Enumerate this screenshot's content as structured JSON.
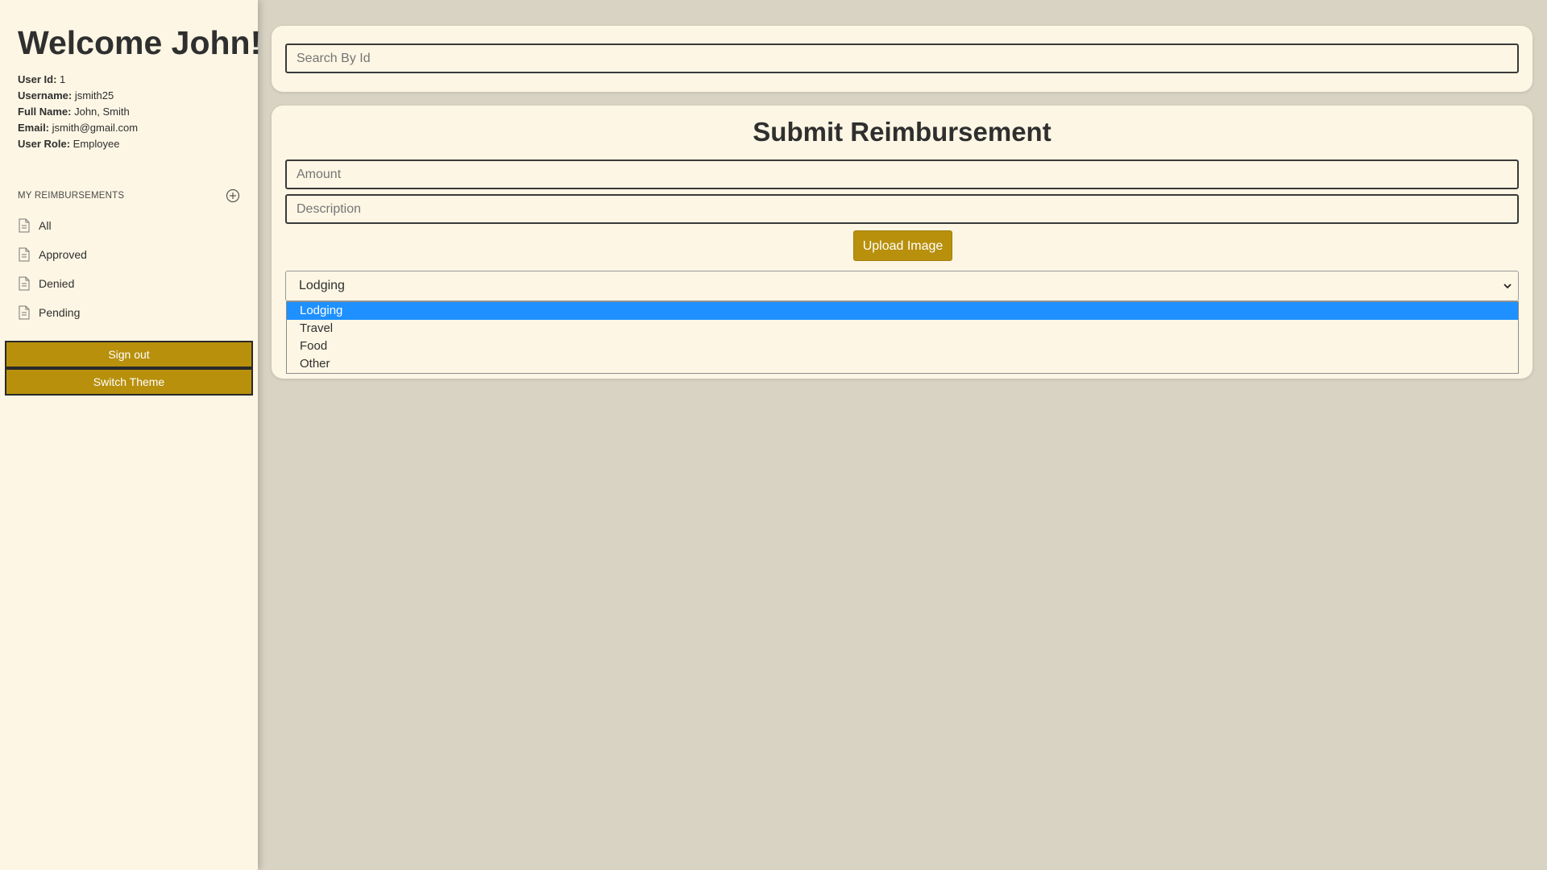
{
  "sidebar": {
    "welcome": "Welcome John!",
    "user_info": [
      {
        "label": "User Id:",
        "value": "1"
      },
      {
        "label": "Username:",
        "value": "jsmith25"
      },
      {
        "label": "Full Name:",
        "value": "John, Smith"
      },
      {
        "label": "Email:",
        "value": "jsmith@gmail.com"
      },
      {
        "label": "User Role:",
        "value": "Employee"
      }
    ],
    "section_title": "MY REIMBURSEMENTS",
    "nav_items": [
      {
        "label": "All",
        "icon": "document-icon"
      },
      {
        "label": "Approved",
        "icon": "document-icon"
      },
      {
        "label": "Denied",
        "icon": "document-icon"
      },
      {
        "label": "Pending",
        "icon": "document-icon"
      }
    ],
    "sign_out_label": "Sign out",
    "switch_theme_label": "Switch Theme"
  },
  "search": {
    "placeholder": "Search By Id"
  },
  "form": {
    "title": "Submit Reimbursement",
    "amount_placeholder": "Amount",
    "description_placeholder": "Description",
    "upload_label": "Upload Image",
    "type_selected": "Lodging",
    "type_options": [
      "Lodging",
      "Travel",
      "Food",
      "Other"
    ]
  },
  "colors": {
    "accent": "#b8900c",
    "background": "#d9d3c4",
    "panel": "#fdf6e4",
    "selected_option": "#1e90ff"
  }
}
